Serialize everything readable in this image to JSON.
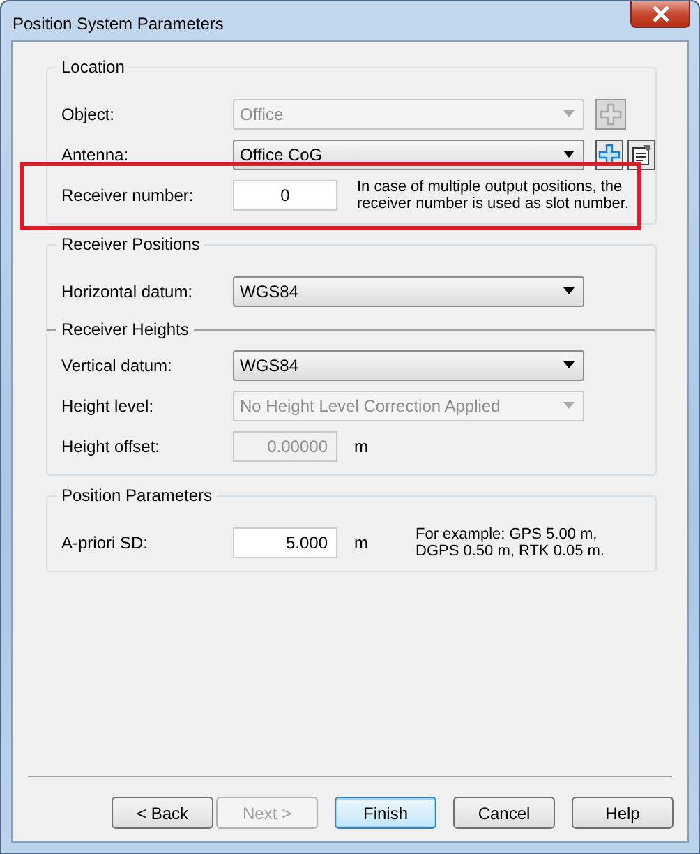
{
  "window": {
    "title": "Position System Parameters"
  },
  "sections": [
    {
      "kind": "box",
      "title": "Location",
      "rows": [
        {
          "label": "Object:",
          "kind": "combo",
          "value": "Office",
          "disabled": true,
          "tools": [
            {
              "kind": "add",
              "disabled": true
            }
          ]
        },
        {
          "label": "Antenna:",
          "kind": "combo",
          "value": "Office CoG",
          "disabled": false,
          "tools": [
            {
              "kind": "add",
              "disabled": false
            },
            {
              "kind": "properties",
              "disabled": false
            }
          ]
        },
        {
          "label": "Receiver number:",
          "kind": "integer",
          "value": "0",
          "disabled": false,
          "highlighted": true,
          "note": "In case of multiple output positions, the receiver number is used as slot number."
        }
      ]
    },
    {
      "kind": "box",
      "title": "Receiver Positions",
      "rows": [
        {
          "label": "Horizontal datum:",
          "kind": "combo",
          "value": "WGS84",
          "disabled": false
        }
      ]
    },
    {
      "kind": "divider",
      "title": "Receiver Heights",
      "rows": [
        {
          "label": "Vertical datum:",
          "kind": "combo",
          "value": "WGS84",
          "disabled": false
        },
        {
          "label": "Height level:",
          "kind": "combo",
          "value": "No Height Level Correction Applied",
          "disabled": true
        },
        {
          "label": "Height offset:",
          "kind": "decimal",
          "value": "0.00000",
          "disabled": true,
          "unit": "m"
        }
      ]
    },
    {
      "kind": "box",
      "title": "Position Parameters",
      "rows": [
        {
          "label": "A-priori SD:",
          "kind": "decimal",
          "value": "5.000",
          "disabled": false,
          "unit": "m",
          "note": "For example: GPS 5.00 m, DGPS 0.50 m, RTK 0.05 m."
        }
      ]
    }
  ],
  "buttons": [
    {
      "label": "< Back",
      "disabled": false,
      "default": false
    },
    {
      "label": "Next >",
      "disabled": true,
      "default": false
    },
    {
      "label": "Finish",
      "disabled": false,
      "default": true
    },
    {
      "label": "Cancel",
      "disabled": false,
      "default": false
    },
    {
      "label": "Help",
      "disabled": false,
      "default": false
    }
  ]
}
